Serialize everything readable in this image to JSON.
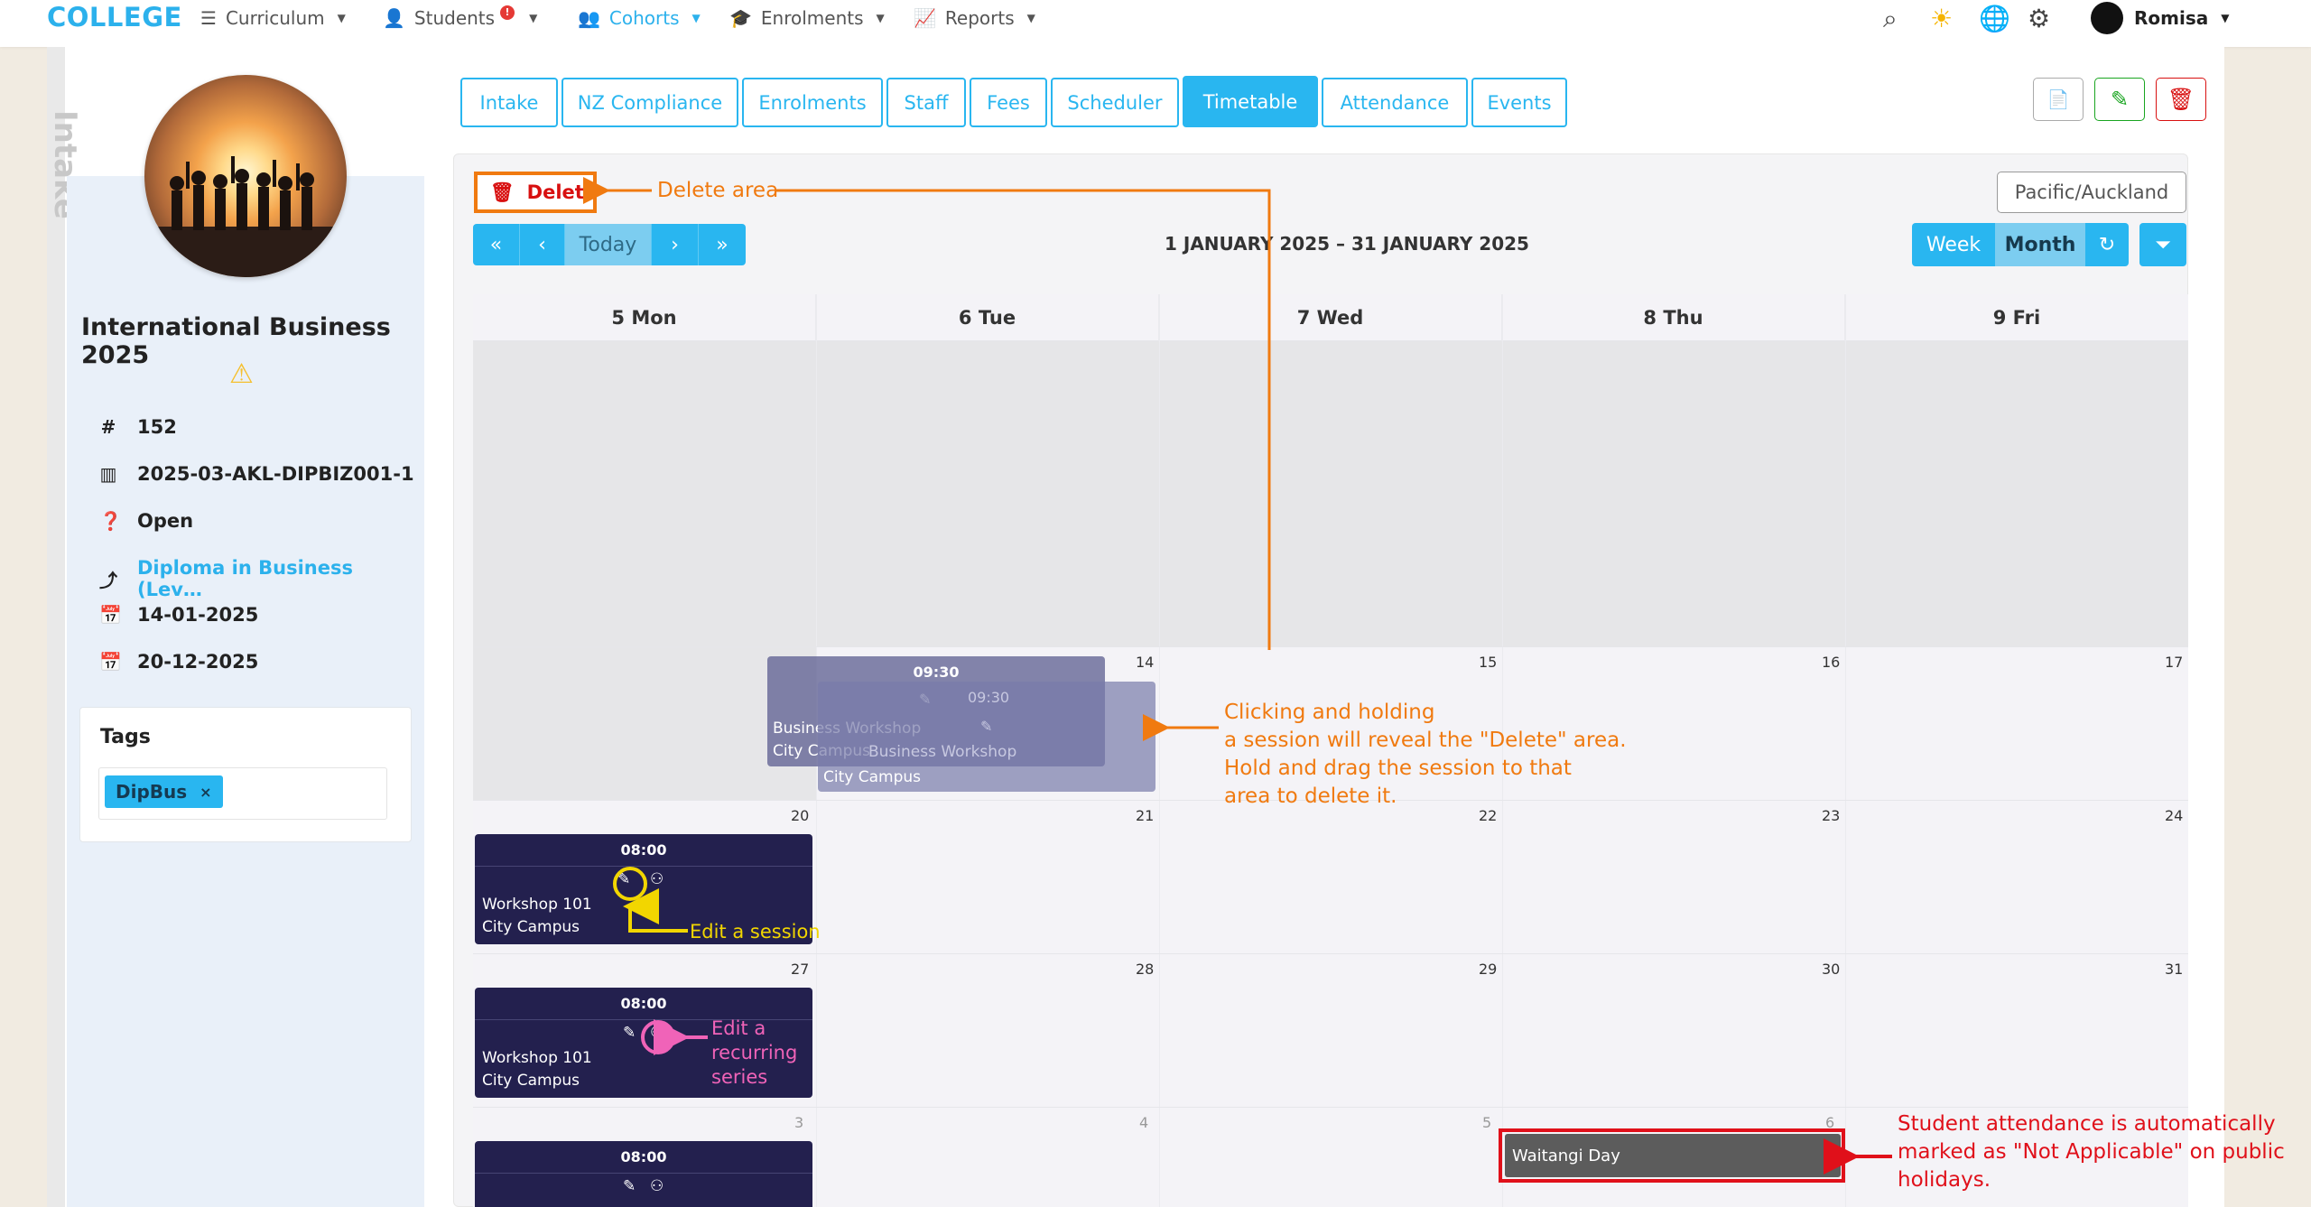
{
  "brand": "COLLEGE",
  "nav": {
    "curriculum": "Curriculum",
    "students": "Students",
    "students_badge": "!",
    "cohorts": "Cohorts",
    "enrolments": "Enrolments",
    "reports": "Reports",
    "user": "Romisa"
  },
  "side_label": "Intake",
  "intake": {
    "title": "International Business 2025",
    "id": "152",
    "code": "2025-03-AKL-DIPBIZ001-1",
    "status": "Open",
    "program": "Diploma in Business (Lev…",
    "start_date": "14-01-2025",
    "end_date": "20-12-2025"
  },
  "tags": {
    "title": "Tags",
    "items": [
      "DipBus"
    ],
    "remove_glyph": "×"
  },
  "tabs": [
    {
      "label": "Intake"
    },
    {
      "label": "NZ Compliance"
    },
    {
      "label": "Enrolments"
    },
    {
      "label": "Staff"
    },
    {
      "label": "Fees"
    },
    {
      "label": "Scheduler"
    },
    {
      "label": "Timetable",
      "active": true
    },
    {
      "label": "Attendance"
    },
    {
      "label": "Events"
    }
  ],
  "calendar": {
    "delete_label": "Delete",
    "timezone": "Pacific/Auckland",
    "today_label": "Today",
    "date_range": "1 JANUARY 2025 – 31 JANUARY 2025",
    "week_label": "Week",
    "month_label": "Month",
    "columns": [
      "5 Mon",
      "6 Tue",
      "7 Wed",
      "8 Thu",
      "9 Fri"
    ],
    "rows": [
      {
        "nums": [
          "",
          "14",
          "15",
          "16",
          "17"
        ]
      },
      {
        "nums": [
          "20",
          "21",
          "22",
          "23",
          "24"
        ]
      },
      {
        "nums": [
          "27",
          "28",
          "29",
          "30",
          "31"
        ]
      },
      {
        "nums": [
          "3",
          "4",
          "5",
          "6",
          ""
        ]
      }
    ],
    "events": {
      "ghost_time": "09:30",
      "ghost_title": "Business Workshop",
      "ghost_location": "City Campus",
      "ghost2_title": "Business Workshop",
      "time": "08:00",
      "title": "Workshop 101",
      "location": "City Campus",
      "holiday": "Waitangi Day"
    }
  },
  "annotations": {
    "delete_area": "Delete area",
    "drag": [
      "Clicking and holding",
      "a session will reveal the \"Delete\" area.",
      "Hold and drag the session to that",
      "area to delete it."
    ],
    "edit_session": "Edit a session",
    "edit_series": [
      "Edit a",
      "recurring",
      "series"
    ],
    "holiday": [
      "Student attendance is automatically",
      "marked as \"Not Applicable\" on public",
      "holidays."
    ]
  },
  "colors": {
    "accent": "#29b6f0",
    "event": "#23204e",
    "annotation_orange": "#f07a10",
    "annotation_yellow": "#f2d600",
    "annotation_pink": "#f063b8",
    "annotation_red": "#e0101a"
  }
}
